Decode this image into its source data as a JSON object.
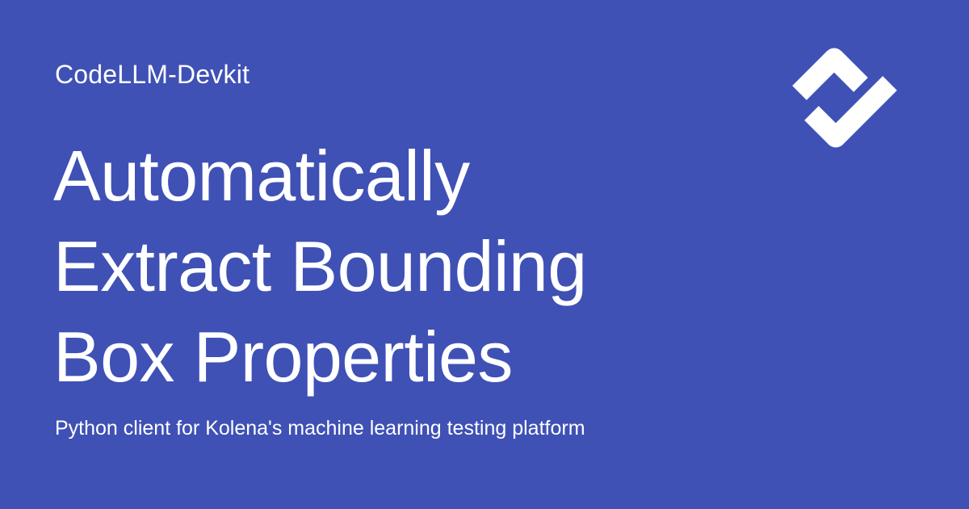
{
  "brand": {
    "name": "CodeLLM-Devkit",
    "logo_icon": "checkmark-logo-icon"
  },
  "hero": {
    "title_lines": [
      "Automatically",
      "Extract Bounding",
      "Box Properties"
    ],
    "subtitle": "Python client for Kolena's machine learning testing platform"
  },
  "colors": {
    "background": "#3f51b5",
    "text": "#ffffff"
  }
}
